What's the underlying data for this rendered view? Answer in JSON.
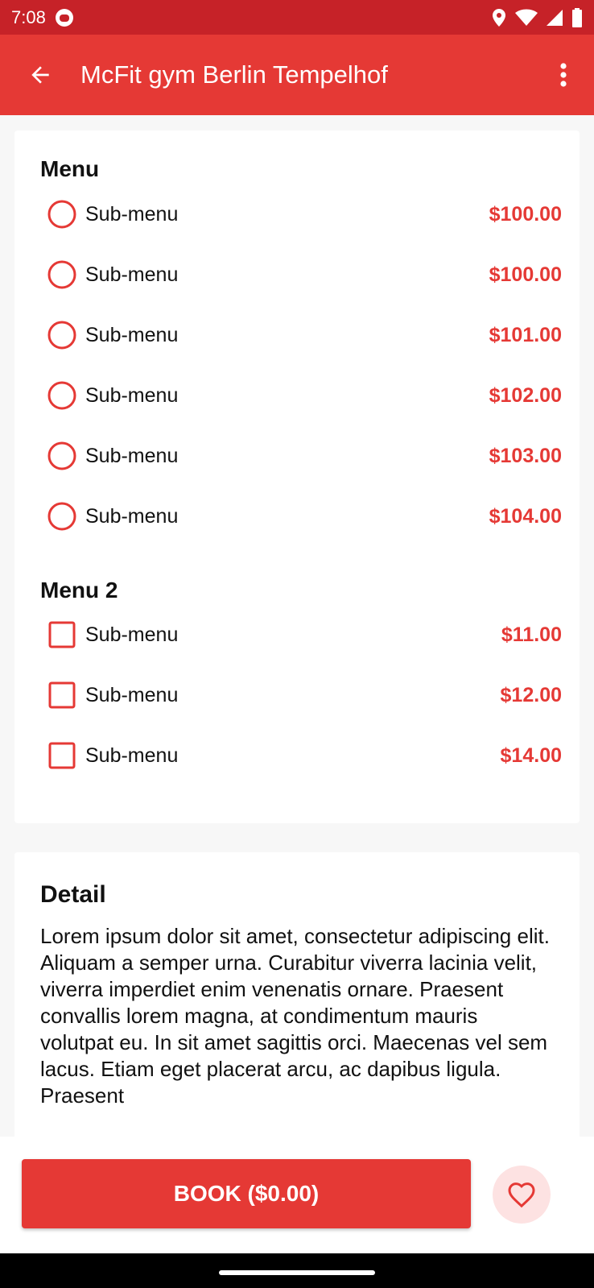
{
  "status_bar": {
    "time": "7:08"
  },
  "app_bar": {
    "title": "McFit gym Berlin Tempelhof"
  },
  "menu1": {
    "title": "Menu",
    "items": [
      {
        "label": "Sub-menu",
        "price": "$100.00"
      },
      {
        "label": "Sub-menu",
        "price": "$100.00"
      },
      {
        "label": "Sub-menu",
        "price": "$101.00"
      },
      {
        "label": "Sub-menu",
        "price": "$102.00"
      },
      {
        "label": "Sub-menu",
        "price": "$103.00"
      },
      {
        "label": "Sub-menu",
        "price": "$104.00"
      }
    ]
  },
  "menu2": {
    "title": "Menu 2",
    "items": [
      {
        "label": "Sub-menu",
        "price": "$11.00"
      },
      {
        "label": "Sub-menu",
        "price": "$12.00"
      },
      {
        "label": "Sub-menu",
        "price": "$14.00"
      }
    ]
  },
  "detail": {
    "title": "Detail",
    "text": "Lorem ipsum dolor sit amet, consectetur adipiscing elit. Aliquam a semper urna. Curabitur viverra lacinia velit, viverra imperdiet enim venenatis ornare. Praesent convallis lorem magna, at condimentum mauris volutpat eu. In sit amet sagittis orci. Maecenas vel sem lacus. Etiam eget placerat arcu, ac dapibus ligula. Praesent"
  },
  "bottom": {
    "book_label": "BOOK ($0.00)"
  },
  "colors": {
    "primary": "#e53935",
    "status": "#c62228",
    "fav_bg": "#fde2e2"
  },
  "icons": [
    "back-arrow-icon",
    "more-vert-icon",
    "heart-icon",
    "location-icon",
    "wifi-icon",
    "signal-icon",
    "battery-icon"
  ]
}
